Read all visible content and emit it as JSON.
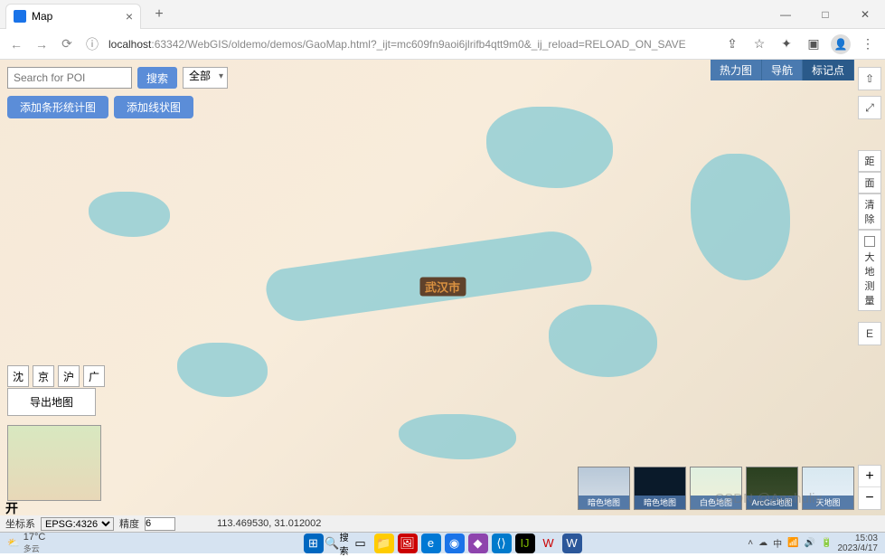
{
  "browser": {
    "tab_title": "Map",
    "url_host": "localhost",
    "url_path": ":63342/WebGIS/oldemo/demos/GaoMap.html?_ijt=mc609fn9aoi6jlrifb4qtt9m0&_ij_reload=RELOAD_ON_SAVE"
  },
  "controls": {
    "search_placeholder": "Search for POI",
    "search_btn": "搜索",
    "category": "全部",
    "add_bar_chart": "添加条形统计图",
    "add_line_chart": "添加线状图"
  },
  "top_nav": {
    "items": [
      "热力图",
      "导航",
      "标记点"
    ]
  },
  "right_tools": {
    "north": "⇧",
    "fullscreen": "⤢",
    "dist": "距",
    "area": "面",
    "clear": "清除",
    "geodesic": "大地测量",
    "east": "E"
  },
  "cities": [
    "沈",
    "京",
    "沪",
    "广"
  ],
  "export_label": "导出地图",
  "open_label": "开",
  "status": {
    "crs_label": "坐标系",
    "crs_value": "EPSG:4326",
    "precision_label": "精度",
    "precision_value": "6",
    "coords": "113.469530, 31.012002"
  },
  "basemaps": [
    "暗色地图",
    "暗色地图",
    "白色地图",
    "ArcGis地图",
    "天地图"
  ],
  "city_label": "武汉市",
  "taskbar": {
    "temp": "17°C",
    "cond": "多云",
    "ime": "中",
    "brand": "CSDN @Anchuliy",
    "time": "15:03",
    "date": "2023/4/17"
  },
  "watermark": "CSDN @Anchuliy"
}
